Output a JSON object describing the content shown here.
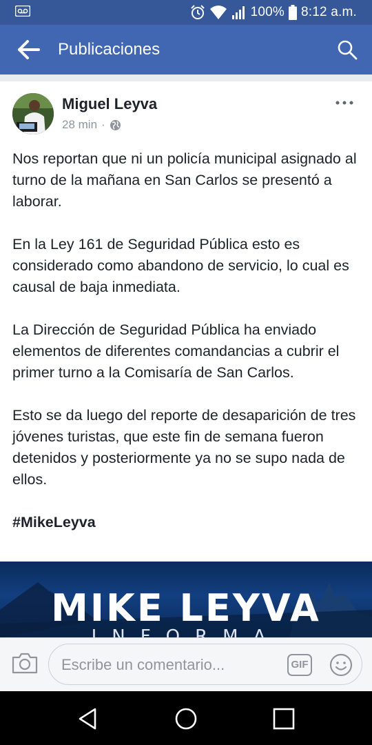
{
  "status_bar": {
    "battery": "100%",
    "time": "8:12 a.m.",
    "icons": [
      "voicemail-icon",
      "alarm-icon",
      "wifi-icon",
      "signal-icon",
      "battery-icon"
    ]
  },
  "app_bar": {
    "title": "Publicaciones",
    "icons": [
      "back-arrow-icon",
      "search-icon"
    ]
  },
  "post": {
    "author": "Miguel Leyva",
    "time": "28 min",
    "separator": "·",
    "privacy_icon": "globe-icon",
    "paragraphs": [
      "Nos reportan que ni un policía municipal asignado al turno de la mañana en San Carlos se presentó a laborar.",
      "En la Ley 161 de Seguridad Pública esto es considerado como abandono de servicio, lo cual es causal de baja inmediata.",
      "La Dirección de Seguridad Pública ha enviado elementos de diferentes comandancias a cubrir el primer turno a la Comisaría de San Carlos.",
      "Esto se da luego del reporte de desaparición de tres jóvenes turistas, que este fin de semana fueron detenidos y posteriormente ya no se supo nada de ellos."
    ],
    "hashtag": "#MikeLeyva",
    "banner": {
      "title": "MIKE LEYVA",
      "subtitle": "INFORMA"
    }
  },
  "comment_bar": {
    "placeholder": "Escribe un comentario...",
    "gif_label": "GIF",
    "icons": [
      "camera-icon",
      "emoji-icon"
    ]
  },
  "colors": {
    "status_bar": "#365899",
    "app_bar": "#4267b2",
    "text": "#1d2129",
    "muted": "#90949c"
  }
}
